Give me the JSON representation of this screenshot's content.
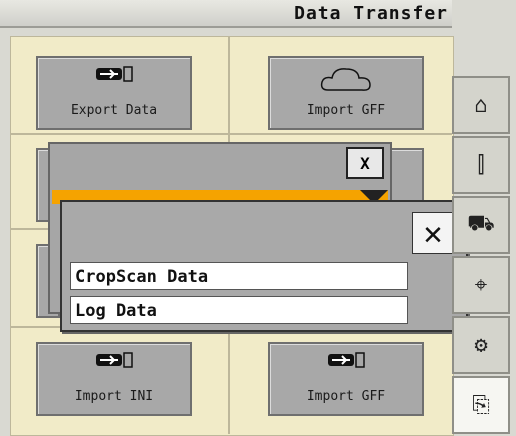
{
  "title": "Data Transfer",
  "tiles": [
    {
      "label": "Export Data",
      "icon": "usb-icon"
    },
    {
      "label": "Import GFF",
      "icon": "cloud-icon"
    },
    {
      "label": "Import INI",
      "icon": "usb-icon"
    },
    {
      "label": "Import GFF",
      "icon": "usb-icon"
    }
  ],
  "dialog1": {
    "close_label": "X"
  },
  "dialog2": {
    "close_label": "✕",
    "options": [
      "CropScan Data",
      "Log Data"
    ]
  },
  "sidebar": {
    "items": [
      {
        "name": "home-icon",
        "glyph": "⌂"
      },
      {
        "name": "bar-chart-icon",
        "glyph": "⫿"
      },
      {
        "name": "harvester-icon",
        "glyph": "⛟"
      },
      {
        "name": "gps-target-icon",
        "glyph": "⌖"
      },
      {
        "name": "settings-gear-icon",
        "glyph": "⚙"
      },
      {
        "name": "data-transfer-icon",
        "glyph": "⎘"
      }
    ]
  },
  "colors": {
    "background": "#f1ebc8",
    "accent": "#f5a300",
    "tile": "#a8a8a8"
  }
}
